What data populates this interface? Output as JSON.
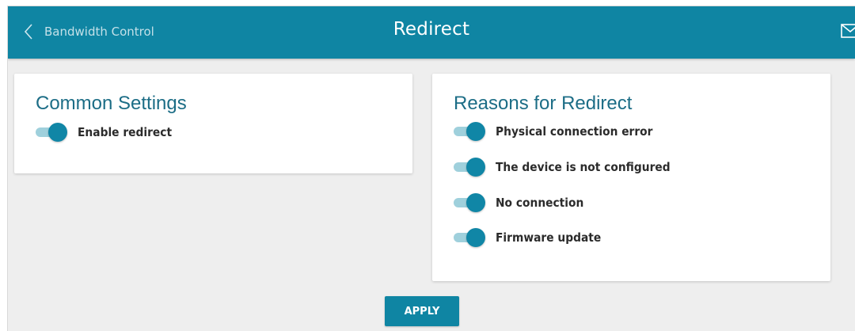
{
  "header": {
    "back_label": "Bandwidth Control",
    "title": "Redirect",
    "accent_color": "#0f85a3"
  },
  "common_settings": {
    "title": "Common Settings",
    "toggles": [
      {
        "label": "Enable redirect",
        "enabled": true
      }
    ]
  },
  "reasons": {
    "title": "Reasons for Redirect",
    "toggles": [
      {
        "label": "Physical connection error",
        "enabled": true
      },
      {
        "label": "The device is not configured",
        "enabled": true
      },
      {
        "label": "No connection",
        "enabled": true
      },
      {
        "label": "Firmware update",
        "enabled": true
      }
    ]
  },
  "actions": {
    "apply_label": "APPLY"
  },
  "icons": {
    "back": "chevron-left-icon",
    "mail": "mail-icon"
  }
}
